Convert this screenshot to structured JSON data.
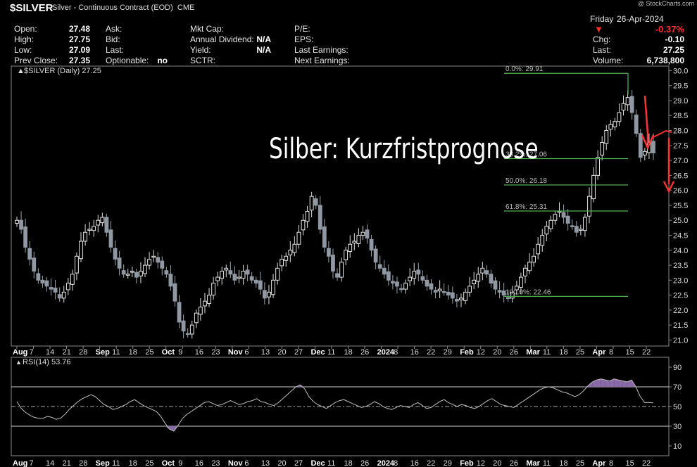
{
  "header": {
    "symbol": "$SILVER",
    "description": "Silver - Continuous Contract (EOD)",
    "exchange": "CME",
    "credit": "@ StockCharts.com",
    "day": "Friday",
    "date": "26-Apr-2024",
    "pct_change": "-0.37%",
    "quote": [
      {
        "label": "Open:",
        "value": "27.48"
      },
      {
        "label": "High:",
        "value": "27.75"
      },
      {
        "label": "Low:",
        "value": "27.09"
      },
      {
        "label": "Prev Close:",
        "value": "27.35"
      }
    ],
    "quote2": [
      {
        "label": "Ask:",
        "value": ""
      },
      {
        "label": "Bid:",
        "value": ""
      },
      {
        "label": "Last:",
        "value": ""
      },
      {
        "label": "Optionable:",
        "value": "no"
      }
    ],
    "quote3": [
      {
        "label": "Mkt Cap:",
        "value": ""
      },
      {
        "label": "Annual Dividend:",
        "value": "N/A"
      },
      {
        "label": "Yield:",
        "value": "N/A"
      },
      {
        "label": "SCTR:",
        "value": ""
      }
    ],
    "quote4": [
      {
        "label": "P/E:",
        "value": ""
      },
      {
        "label": "EPS:",
        "value": ""
      },
      {
        "label": "Last Earnings:",
        "value": ""
      },
      {
        "label": "Next Earnings:",
        "value": ""
      }
    ],
    "quote5": [
      {
        "label": "Chg:",
        "value": "-0.10"
      },
      {
        "label": "Last:",
        "value": "27.25"
      },
      {
        "label": "Volume:",
        "value": "6,738,800"
      }
    ]
  },
  "chart_data": [
    {
      "type": "candlestick",
      "legend": "$SILVER (Daily) 27.25",
      "overlay_title": "Silber: Kurzfristprognose",
      "ylim": [
        20.8,
        30.15
      ],
      "y_ticks": [
        "30.0",
        "29.5",
        "29.0",
        "28.5",
        "28.0",
        "27.5",
        "27.0",
        "26.5",
        "26.0",
        "25.5",
        "25.0",
        "24.5",
        "24.0",
        "23.5",
        "23.0",
        "22.5",
        "22.0",
        "21.5",
        "21.0"
      ],
      "x_ticks": [
        "Aug",
        "7",
        "14",
        "21",
        "28",
        "Sep",
        "11",
        "18",
        "25",
        "Oct",
        "9",
        "16",
        "23",
        "Nov",
        "6",
        "13",
        "20",
        "27",
        "Dec",
        "11",
        "18",
        "26",
        "2024",
        "8",
        "16",
        "22",
        "29",
        "Feb",
        "12",
        "20",
        "26",
        "Mar",
        "11",
        "18",
        "25",
        "Apr",
        "8",
        "15",
        "22"
      ],
      "x_ticks_bold": [
        "Aug",
        "Sep",
        "Oct",
        "Nov",
        "Dec",
        "2024",
        "Feb",
        "Mar",
        "Apr"
      ],
      "fibonacci": [
        {
          "label": "0.0%: 29.91",
          "value": 29.91
        },
        {
          "label": "38.2%: 27.06",
          "value": 27.06
        },
        {
          "label": "50.0%: 26.18",
          "value": 26.18
        },
        {
          "label": "61.8%: 25.31",
          "value": 25.31
        },
        {
          "label": "100.0%: 22.46",
          "value": 22.46
        }
      ],
      "closes": [
        25.0,
        24.7,
        24.1,
        23.7,
        23.3,
        23.0,
        22.9,
        22.8,
        22.7,
        22.6,
        22.4,
        22.6,
        22.9,
        23.2,
        23.8,
        24.3,
        24.6,
        24.7,
        24.8,
        25.0,
        25.1,
        24.6,
        24.1,
        23.7,
        23.4,
        23.2,
        23.2,
        23.3,
        23.1,
        23.3,
        23.5,
        23.7,
        23.8,
        23.6,
        23.4,
        23.2,
        22.8,
        22.3,
        21.6,
        21.3,
        21.2,
        21.5,
        21.9,
        22.1,
        22.3,
        22.5,
        22.9,
        23.1,
        23.3,
        23.4,
        23.2,
        23.0,
        23.1,
        23.3,
        23.2,
        23.0,
        22.9,
        22.7,
        22.4,
        22.6,
        23.0,
        23.4,
        23.7,
        23.8,
        24.0,
        24.2,
        24.6,
        25.0,
        25.3,
        25.8,
        25.5,
        24.7,
        24.1,
        23.8,
        23.3,
        23.1,
        23.6,
        24.0,
        24.2,
        24.3,
        24.5,
        24.6,
        24.4,
        24.0,
        23.6,
        23.4,
        23.2,
        23.0,
        22.9,
        22.8,
        22.7,
        22.9,
        23.1,
        23.3,
        23.2,
        23.0,
        22.8,
        22.7,
        22.6,
        22.7,
        22.6,
        22.5,
        22.4,
        22.3,
        22.4,
        22.6,
        22.8,
        23.0,
        23.2,
        23.4,
        23.2,
        22.9,
        22.7,
        22.6,
        22.5,
        22.4,
        22.6,
        22.8,
        23.1,
        23.4,
        23.6,
        23.8,
        24.2,
        24.5,
        24.8,
        25.0,
        25.2,
        25.3,
        25.1,
        24.9,
        24.8,
        24.6,
        24.7,
        25.1,
        25.8,
        26.5,
        27.1,
        27.6,
        28.0,
        28.2,
        28.3,
        28.6,
        28.9,
        29.1,
        28.6,
        27.9,
        27.1,
        27.3,
        27.6,
        27.25
      ],
      "rsi": {
        "legend": "RSI(14) 53.76",
        "ylim": [
          0,
          100
        ],
        "ticks": [
          "90",
          "70",
          "50",
          "30",
          "10"
        ],
        "values": [
          55,
          48,
          44,
          41,
          39,
          38,
          38,
          40,
          39,
          37,
          38,
          42,
          47,
          51,
          55,
          58,
          60,
          62,
          60,
          56,
          52,
          50,
          47,
          48,
          50,
          52,
          55,
          57,
          54,
          51,
          49,
          47,
          45,
          40,
          33,
          27,
          25,
          31,
          38,
          42,
          45,
          48,
          51,
          54,
          55,
          53,
          51,
          52,
          54,
          56,
          54,
          52,
          53,
          55,
          56,
          58,
          55,
          54,
          52,
          51,
          54,
          58,
          62,
          66,
          70,
          72,
          68,
          60,
          55,
          52,
          50,
          48,
          51,
          54,
          56,
          57,
          55,
          53,
          51,
          49,
          50,
          52,
          55,
          53,
          50,
          48,
          47,
          49,
          51,
          50,
          49,
          52,
          54,
          51,
          48,
          49,
          52,
          55,
          57,
          54,
          52,
          50,
          52,
          51,
          49,
          48,
          50,
          53,
          56,
          58,
          55,
          52,
          51,
          50,
          49,
          52,
          55,
          58,
          61,
          64,
          67,
          69,
          70,
          69,
          67,
          65,
          64,
          62,
          60,
          62,
          66,
          71,
          75,
          77,
          78,
          77,
          76,
          78,
          77,
          76,
          75,
          77,
          70,
          60,
          54,
          54,
          53.76
        ]
      }
    }
  ]
}
